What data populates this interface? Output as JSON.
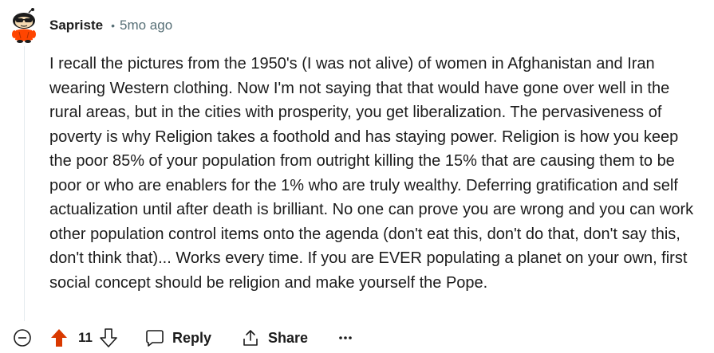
{
  "comment": {
    "author": "Sapriste",
    "separator": "•",
    "age": "5mo ago",
    "body": "I recall the pictures from the 1950's (I was not alive) of women in Afghanistan and Iran wearing Western clothing. Now I'm not saying that that would have gone over well in the rural areas, but in the cities with prosperity, you get liberalization. The pervasiveness of poverty is why Religion takes a foothold and has staying power. Religion is how you keep the poor 85% of your population from outright killing the 15% that are causing them to be poor or who are enablers for the 1% who are truly wealthy. Deferring gratification and self actualization until after death is brilliant. No one can prove you are wrong and you can work other population control items onto the agenda (don't eat this, don't do that, don't say this, don't think that)... Works every time. If you are EVER populating a planet on your own, first social concept should be religion and make yourself the Pope.",
    "score": "11"
  },
  "actions": {
    "reply_label": "Reply",
    "share_label": "Share"
  },
  "icons": {
    "collapse": "collapse-minus-icon",
    "upvote": "upvote-arrow-icon",
    "downvote": "downvote-arrow-icon",
    "reply": "speech-bubble-icon",
    "share": "share-arrow-icon",
    "more": "ellipsis-icon"
  },
  "colors": {
    "upvote_active": "#d93900",
    "text": "#1c1c1c",
    "meta": "#576f76",
    "avatar_shirt": "#ff4500"
  }
}
